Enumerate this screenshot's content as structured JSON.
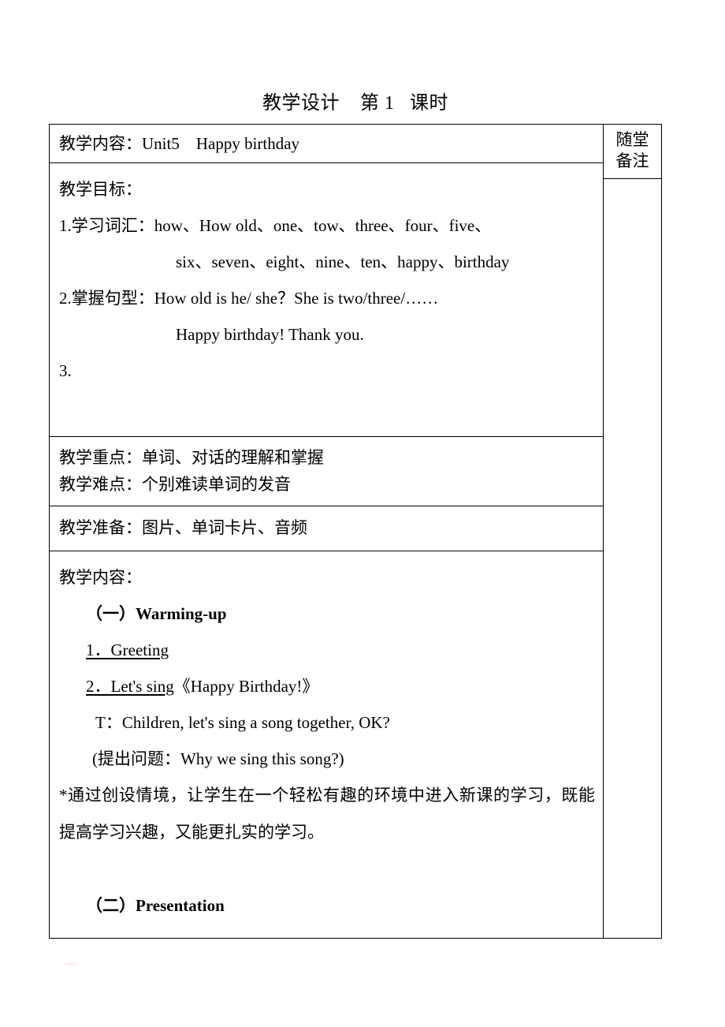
{
  "document": {
    "title": "教学设计    第 1   课时"
  },
  "table": {
    "notes_header": [
      "随堂",
      "备注"
    ],
    "content_row": {
      "label": "教学内容：",
      "value": "Unit5　Happy birthday"
    },
    "objectives": {
      "heading": "教学目标：",
      "item1_label": "1.学习词汇：",
      "item1_line1": "how、How old、one、tow、three、four、five、",
      "item1_line2": "six、seven、eight、nine、ten、happy、birthday",
      "item2_label": "2.掌握句型：",
      "item2_line1": "How old is he/ she？She is two/three/……",
      "item2_line2": "Happy birthday! Thank you.",
      "item3": "3."
    },
    "focus": {
      "key_point": "教学重点：单词、对话的理解和掌握",
      "difficulty": "教学难点：个别难读单词的发音"
    },
    "preparation": {
      "text": "教学准备：图片、单词卡片、音频"
    },
    "process": {
      "heading": "教学内容：",
      "section_one": "（一）Warming-up",
      "step1": "1．Greeting",
      "step2_underlined": "2．Let's sing",
      "step2_rest": "《Happy Birthday!》",
      "teacher_line": "T：Children, let's sing a song together, OK?",
      "question_line": "(提出问题：Why we sing this song?)",
      "note_paragraph": "*通过创设情境，让学生在一个轻松有趣的环境中进入新课的学习，既能提高学习兴趣，又能更扎实的学习。",
      "section_two": "（二）Presentation"
    }
  }
}
